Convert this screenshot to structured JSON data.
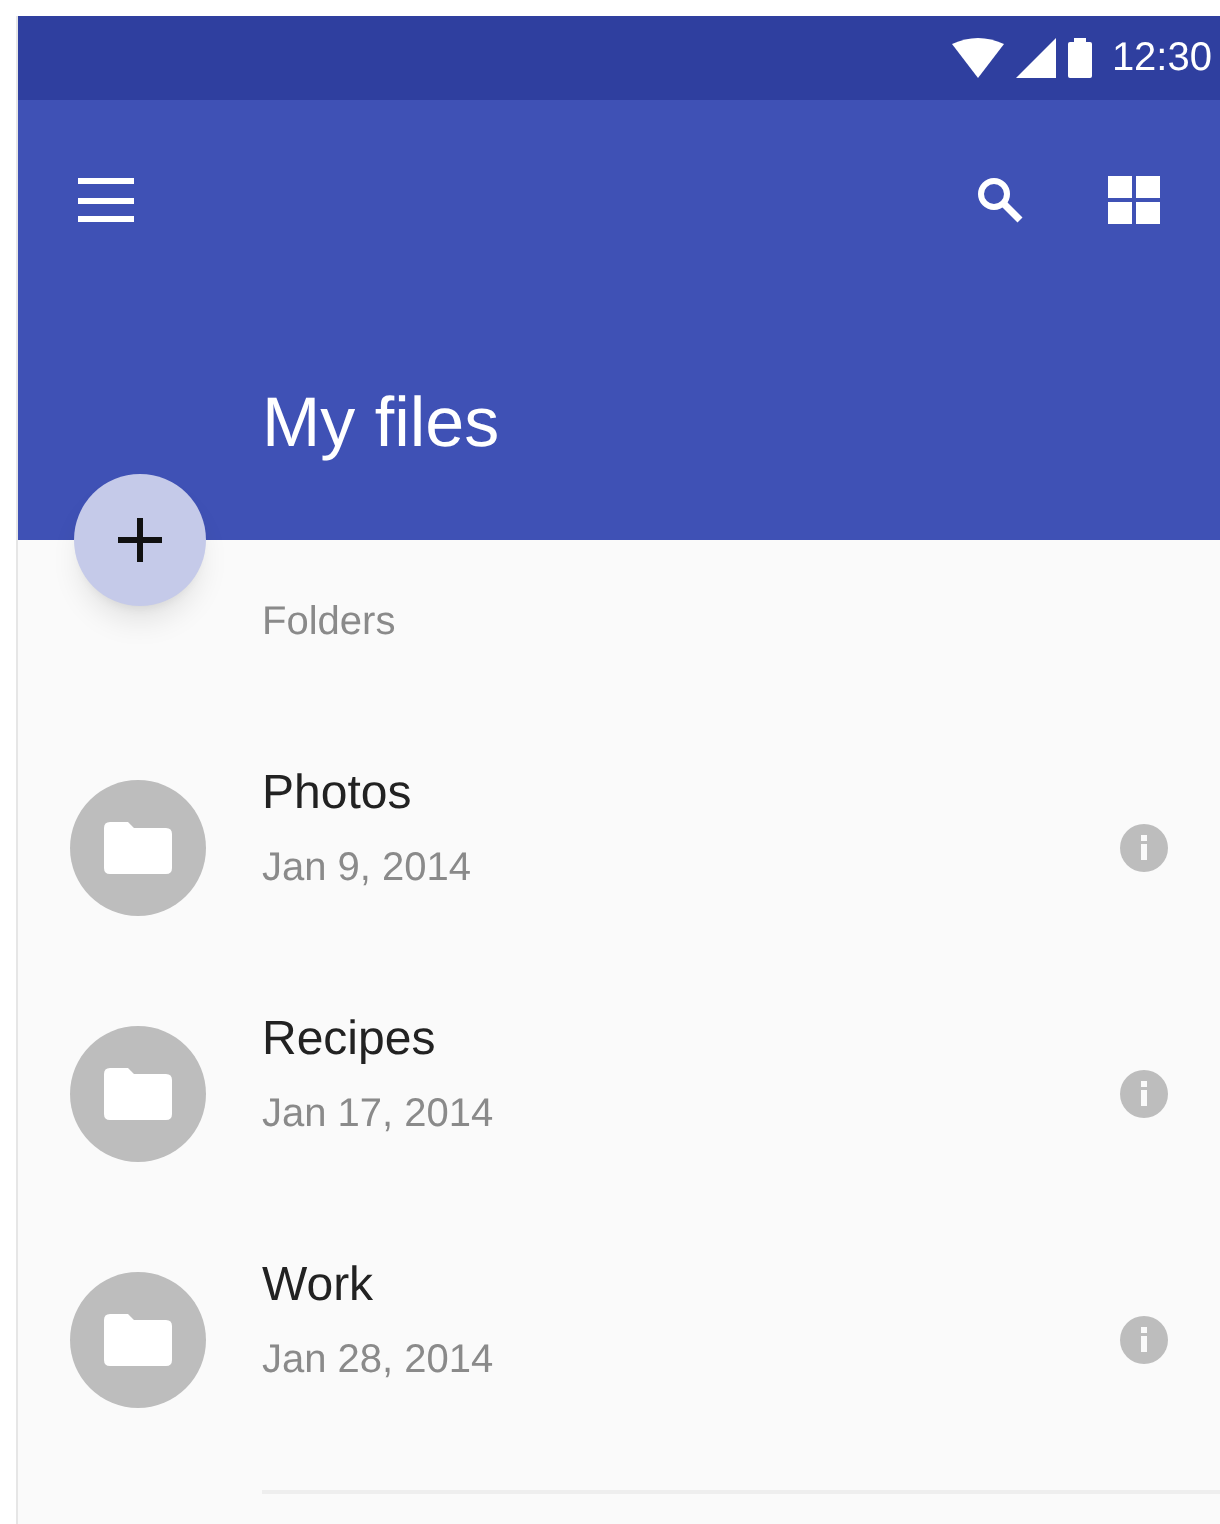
{
  "status_bar": {
    "time": "12:30"
  },
  "app_bar": {
    "title": "My files"
  },
  "section": {
    "title": "Folders"
  },
  "folders": [
    {
      "name": "Photos",
      "date": "Jan 9, 2014"
    },
    {
      "name": "Recipes",
      "date": "Jan 17, 2014"
    },
    {
      "name": "Work",
      "date": "Jan 28, 2014"
    }
  ]
}
